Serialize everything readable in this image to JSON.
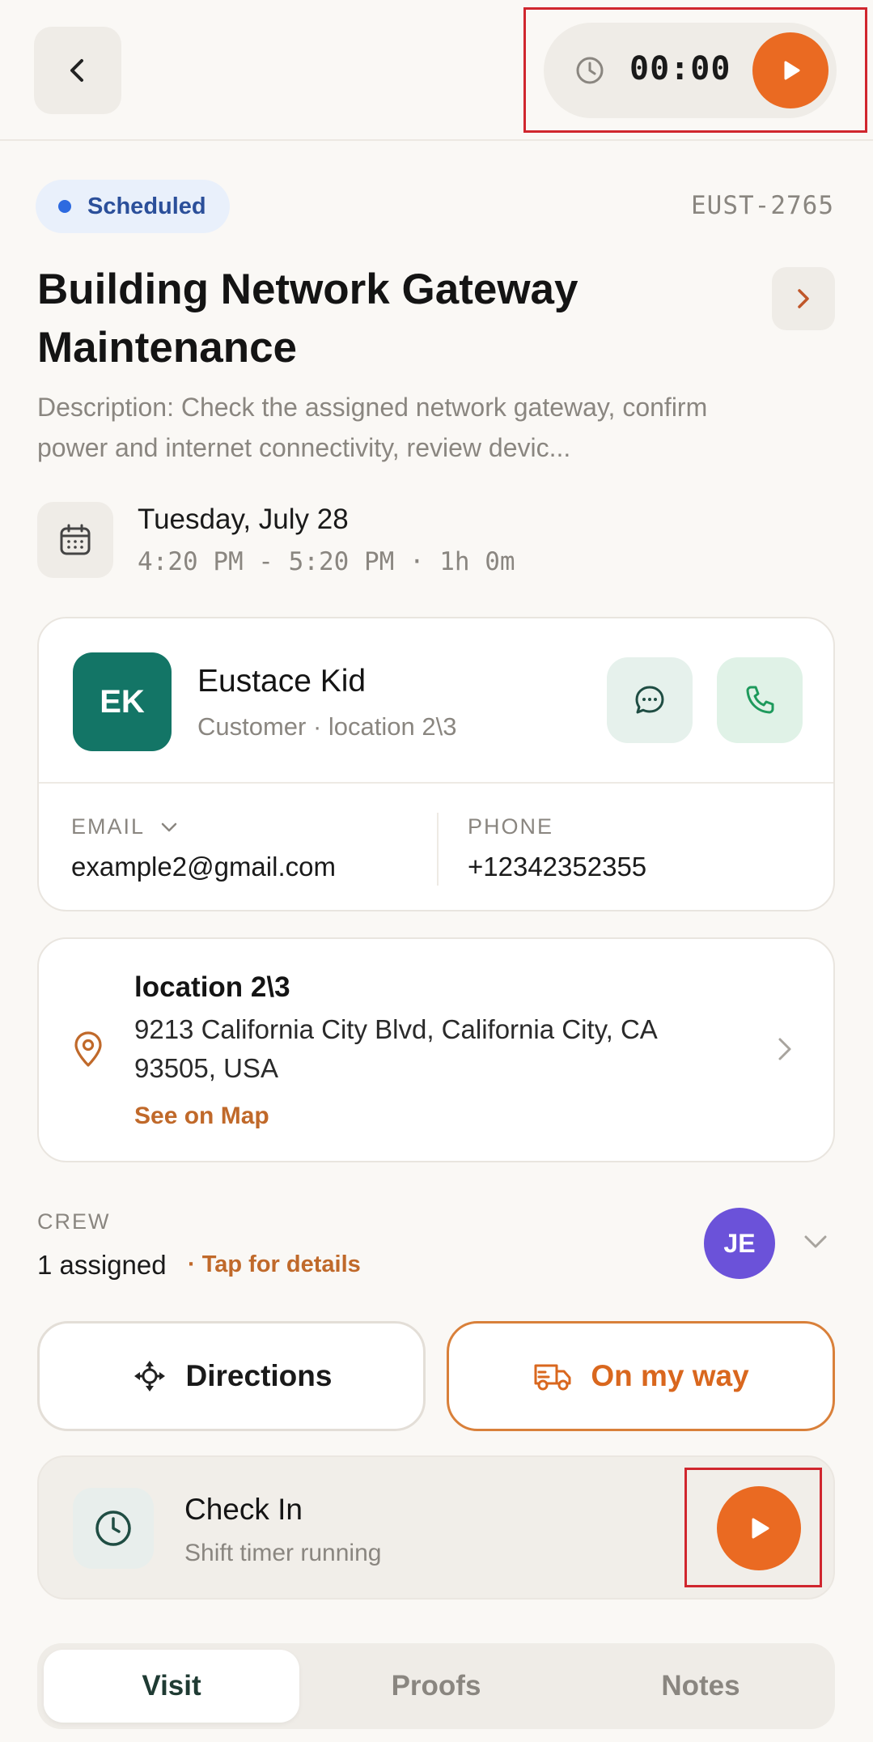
{
  "header": {
    "back_icon": "chevron-left-icon",
    "timer": {
      "clock_icon": "clock-icon",
      "value": "00:00",
      "play_icon": "play-icon"
    }
  },
  "job": {
    "status": "Scheduled",
    "status_color": "#2d6ae0",
    "code": "EUST-2765",
    "title": "Building Network Gateway Maintenance",
    "description": "Description: Check the assigned network gateway, confirm power and internet connectivity, review devic...",
    "date": "Tuesday, July 28",
    "time": "4:20 PM - 5:20 PM · 1h 0m"
  },
  "customer": {
    "initials": "EK",
    "name": "Eustace Kid",
    "subtitle": "Customer · location 2\\3",
    "email_label": "EMAIL",
    "email": "example2@gmail.com",
    "phone_label": "PHONE",
    "phone": "+12342352355"
  },
  "location": {
    "name": "location 2\\3",
    "address": "9213 California City Blvd, California City, CA 93505, USA",
    "map_link": "See on Map"
  },
  "crew": {
    "label": "CREW",
    "count": "1 assigned",
    "details_link": "· Tap for details",
    "avatar_initials": "JE"
  },
  "actions": {
    "directions": "Directions",
    "on_my_way": "On my way"
  },
  "checkin": {
    "title": "Check In",
    "subtitle": "Shift timer running"
  },
  "tabs": [
    {
      "label": "Visit",
      "active": true
    },
    {
      "label": "Proofs",
      "active": false
    },
    {
      "label": "Notes",
      "active": false
    }
  ],
  "colors": {
    "accent": "#ea6a22",
    "avatar_customer": "#137566",
    "avatar_crew": "#6b52d9",
    "highlight_box": "#d0262e"
  }
}
